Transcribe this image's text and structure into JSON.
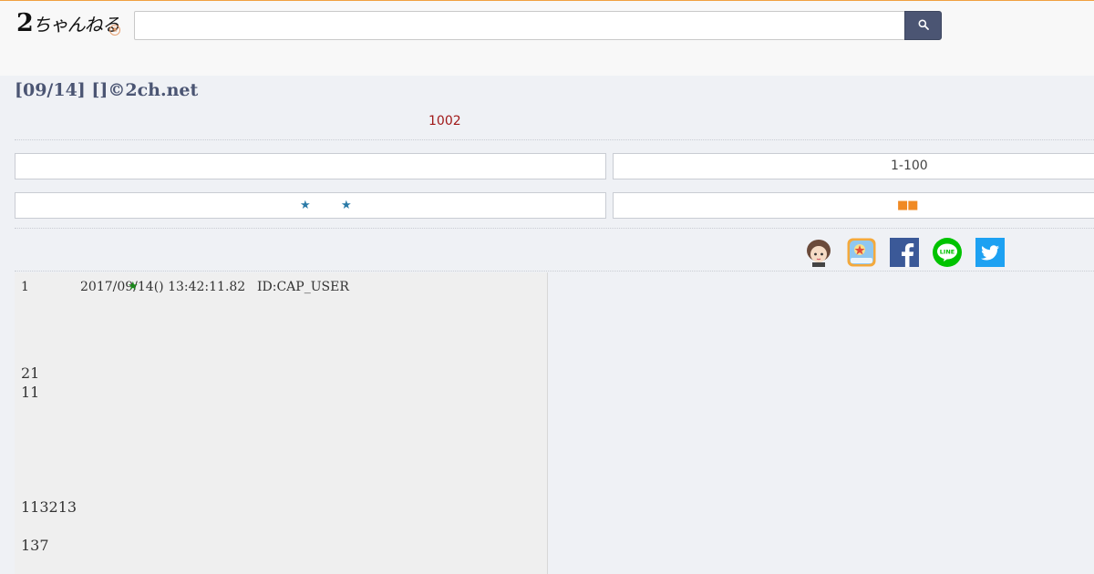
{
  "header": {
    "logo_prefix": "2",
    "logo_text": "ちゃんねる",
    "search_placeholder": "",
    "search_icon": "magnifier-icon"
  },
  "thread": {
    "title": "[09/14] []©2ch.net",
    "count": "1002"
  },
  "nav": {
    "top_left": "",
    "top_right": "1-100",
    "bottom_left_icons": [
      "star-icon",
      "star-icon"
    ],
    "bottom_right_icons": [
      "square-icon",
      "square-icon"
    ]
  },
  "share": [
    "mascot-icon",
    "2ch-app-icon",
    "facebook-icon",
    "line-icon",
    "twitter-icon"
  ],
  "post": {
    "number": "1",
    "date": "2017/09/14() 13:42:11.82",
    "id": "ID:CAP_USER",
    "lines": [
      "21",
      "11",
      "113213",
      "137"
    ]
  },
  "colors": {
    "accent": "#4b5573",
    "count_red": "#a01818",
    "star_blue": "#2a7aa7",
    "square_orange": "#f08a24",
    "post_star_green": "#1a8a1a"
  }
}
